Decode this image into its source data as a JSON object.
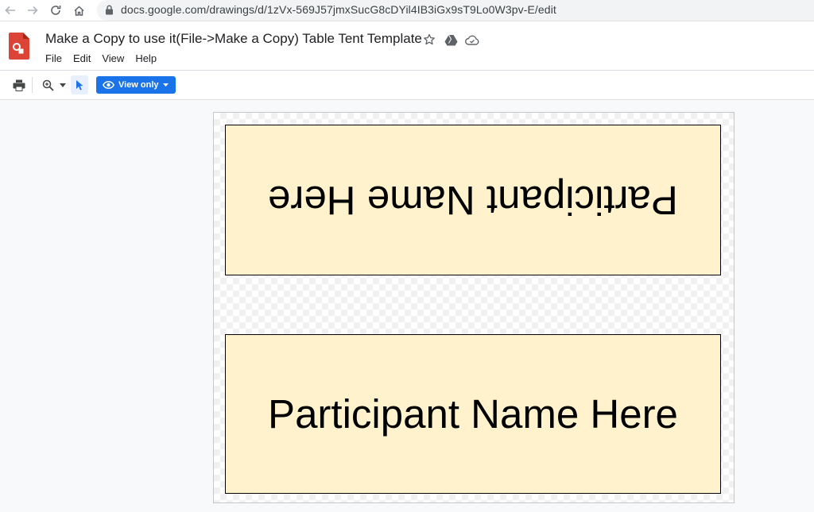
{
  "browser": {
    "url": "docs.google.com/drawings/d/1zVx-569J57jmxSucG8cDYil4IB3iGx9sT9Lo0W3pv-E/edit"
  },
  "app": {
    "title": "Make a Copy to use it(File->Make a Copy) Table Tent Template",
    "menu": [
      "File",
      "Edit",
      "View",
      "Help"
    ]
  },
  "toolbar": {
    "view_mode_label": "View only"
  },
  "canvas": {
    "panels": [
      {
        "text": "Participant Name Here",
        "orientation": "upside-down"
      },
      {
        "text": "Participant Name Here",
        "orientation": "upright"
      }
    ],
    "panel_fill": "#fff2cc",
    "accent": "#1a73e8"
  },
  "icons": [
    "back-arrow-icon",
    "forward-arrow-icon",
    "reload-icon",
    "home-icon",
    "lock-icon",
    "drawings-logo-icon",
    "star-icon",
    "drive-move-icon",
    "cloud-status-icon",
    "print-icon",
    "zoom-icon",
    "chevron-down-icon",
    "select-pointer-icon",
    "eye-icon"
  ]
}
